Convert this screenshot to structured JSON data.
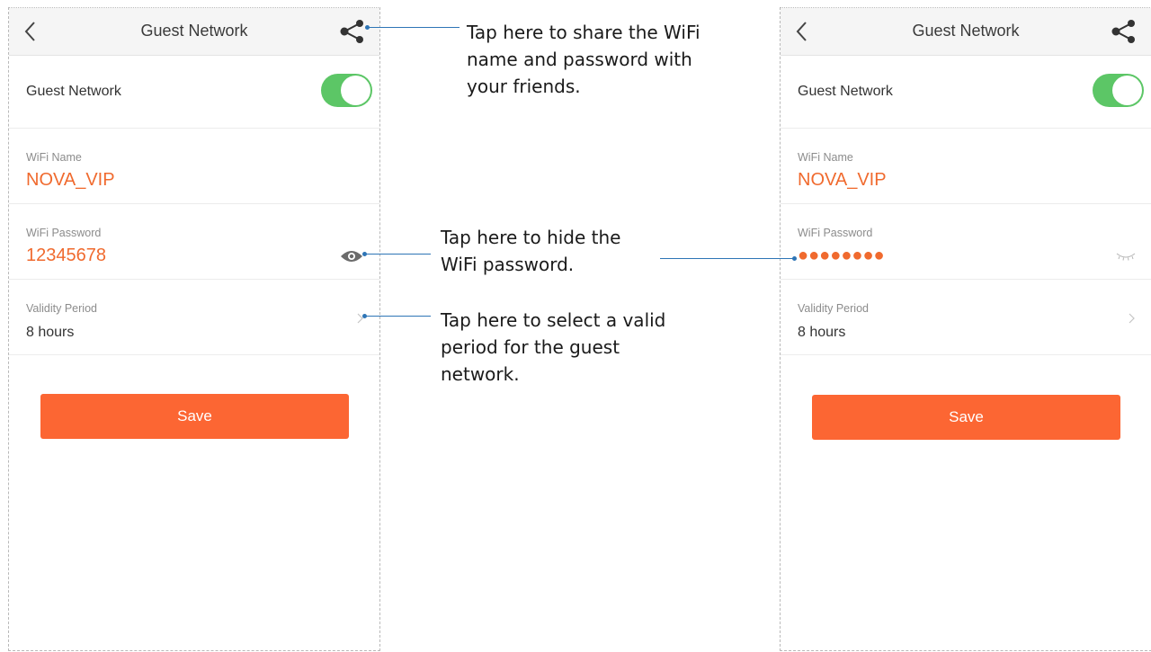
{
  "left_phone": {
    "navbar": {
      "title": "Guest Network"
    },
    "guest_network": {
      "label": "Guest Network",
      "enabled": true
    },
    "wifi_name": {
      "label": "WiFi Name",
      "value": "NOVA_VIP"
    },
    "wifi_password": {
      "label": "WiFi Password",
      "value": "12345678",
      "icon": "eye-icon"
    },
    "validity_period": {
      "label": "Validity Period",
      "value": "8 hours"
    },
    "save_label": "Save"
  },
  "right_phone": {
    "navbar": {
      "title": "Guest Network"
    },
    "guest_network": {
      "label": "Guest Network",
      "enabled": true
    },
    "wifi_name": {
      "label": "WiFi Name",
      "value": "NOVA_VIP"
    },
    "wifi_password": {
      "label": "WiFi Password",
      "value": "●●●●●●●●",
      "icon": "eye-closed-icon"
    },
    "validity_period": {
      "label": "Validity Period",
      "value": "8 hours"
    },
    "save_label": "Save"
  },
  "annotations": {
    "share": "Tap here to share the WiFi\nname and password with\nyour friends.",
    "hide_password": "Tap here to hide the\nWiFi password.",
    "validity_period": "Tap here to select a valid\nperiod for the guest\nnetwork."
  },
  "colors": {
    "accent": "#fc6633",
    "value_text": "#f06a2e",
    "toggle_on": "#5cc666",
    "callout_line": "#2e75b6"
  }
}
